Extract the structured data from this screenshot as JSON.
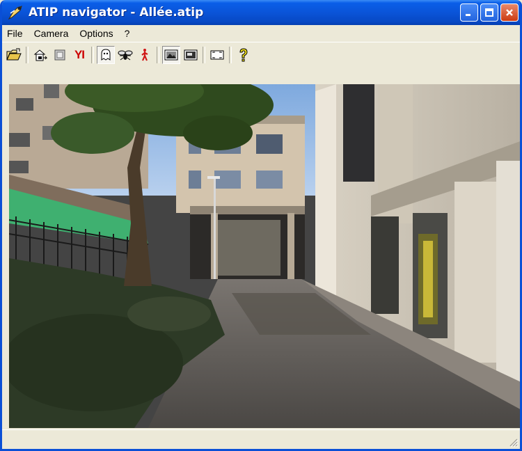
{
  "window": {
    "title": "ATIP navigator - Allée.atip",
    "title_color": "#ffffff",
    "titlebar_color": "#0a54d8"
  },
  "menu": {
    "items": [
      {
        "label": "File"
      },
      {
        "label": "Camera"
      },
      {
        "label": "Options"
      },
      {
        "label": "?"
      }
    ]
  },
  "toolbar": {
    "buttons": [
      {
        "icon": "open-folder-icon"
      },
      {
        "icon": "camera-position-icon"
      },
      {
        "icon": "frame-icon"
      },
      {
        "icon": "yi-icon",
        "text": "YI"
      },
      {
        "icon": "ghost-icon",
        "pressed": true
      },
      {
        "icon": "fly-icon"
      },
      {
        "icon": "walker-icon"
      },
      {
        "icon": "image-view-1-icon",
        "pressed": true
      },
      {
        "icon": "image-view-2-icon"
      },
      {
        "icon": "fullscreen-icon"
      },
      {
        "icon": "help-icon"
      }
    ]
  },
  "viewport": {
    "description_colors": {
      "sky": "#8fb7e6",
      "road": "#5f5a55",
      "grass": "#2d3a26",
      "fence_green": "#3fb070"
    }
  },
  "statusbar": {
    "text": ""
  }
}
